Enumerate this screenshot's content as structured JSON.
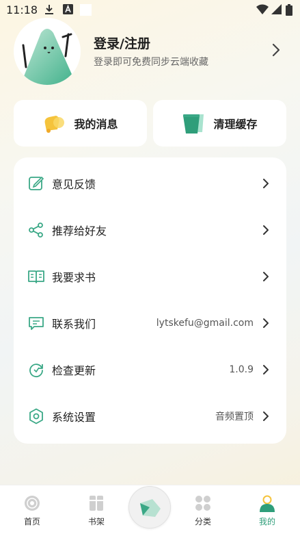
{
  "status_bar": {
    "time": "11:18",
    "icons": [
      "download-icon",
      "a-badge-icon",
      "white-square-icon",
      "wifi-icon",
      "signal-icon",
      "battery-icon"
    ]
  },
  "profile": {
    "title": "登录/注册",
    "subtitle": "登录即可免费同步云端收藏"
  },
  "quick_actions": [
    {
      "label": "我的消息",
      "icon": "bell-icon"
    },
    {
      "label": "清理缓存",
      "icon": "trash-icon"
    }
  ],
  "menu": [
    {
      "label": "意见反馈",
      "value": "",
      "icon": "edit-feedback-icon"
    },
    {
      "label": "推荐给好友",
      "value": "",
      "icon": "share-icon"
    },
    {
      "label": "我要求书",
      "value": "",
      "icon": "book-open-icon"
    },
    {
      "label": "联系我们",
      "value": "lytskefu@gmail.com",
      "icon": "message-icon"
    },
    {
      "label": "检查更新",
      "value": "1.0.9",
      "icon": "refresh-icon"
    },
    {
      "label": "系统设置",
      "value": "音频置顶",
      "icon": "settings-hex-icon"
    }
  ],
  "bottom_nav": [
    {
      "label": "首页",
      "icon": "disc-home-icon",
      "active": false
    },
    {
      "label": "书架",
      "icon": "bookshelf-icon",
      "active": false
    },
    {
      "label": "分类",
      "icon": "grid-category-icon",
      "active": false
    },
    {
      "label": "我的",
      "icon": "person-icon",
      "active": true
    }
  ],
  "colors": {
    "accent": "#2f9e7a",
    "icon_green": "#3aa886",
    "bell_yellow": "#f5c33b",
    "card_bg": "#ffffff"
  }
}
